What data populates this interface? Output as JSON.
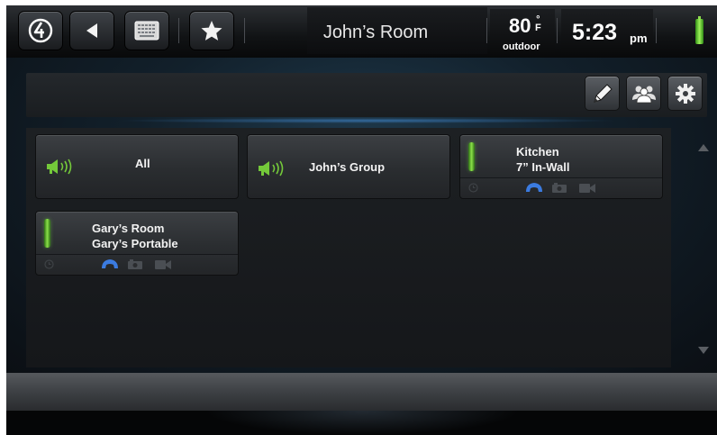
{
  "header": {
    "room_title": "John’s Room",
    "temperature": "80",
    "temperature_unit_symbol": "°",
    "temperature_unit": "F",
    "temperature_label": "outdoor",
    "time": "5:23",
    "ampm": "pm"
  },
  "nav": {
    "buttons": [
      {
        "icon": "logo-icon"
      },
      {
        "icon": "back-icon"
      },
      {
        "icon": "keypad-icon"
      },
      {
        "icon": "star-icon"
      }
    ]
  },
  "toolbar": {
    "buttons": [
      {
        "icon": "edit-icon"
      },
      {
        "icon": "group-icon"
      },
      {
        "icon": "settings-icon"
      }
    ]
  },
  "tiles": [
    {
      "type": "group",
      "name": "All",
      "icon": "speaker-icon"
    },
    {
      "type": "group",
      "name": "John’s Group",
      "icon": "speaker-icon"
    },
    {
      "type": "room",
      "line1": "Kitchen",
      "line2": "7” In-Wall",
      "footer_icons": [
        "clock-icon",
        "phone-icon",
        "camera-icon",
        "video-icon"
      ]
    },
    {
      "type": "room",
      "line1": "Gary’s Room",
      "line2": "Gary’s Portable",
      "footer_icons": [
        "clock-icon",
        "phone-icon",
        "camera-icon",
        "video-icon"
      ]
    }
  ],
  "colors": {
    "accent_green": "#7ad13d",
    "phone_blue": "#3b7be0",
    "panel_glow": "#4696e6"
  }
}
